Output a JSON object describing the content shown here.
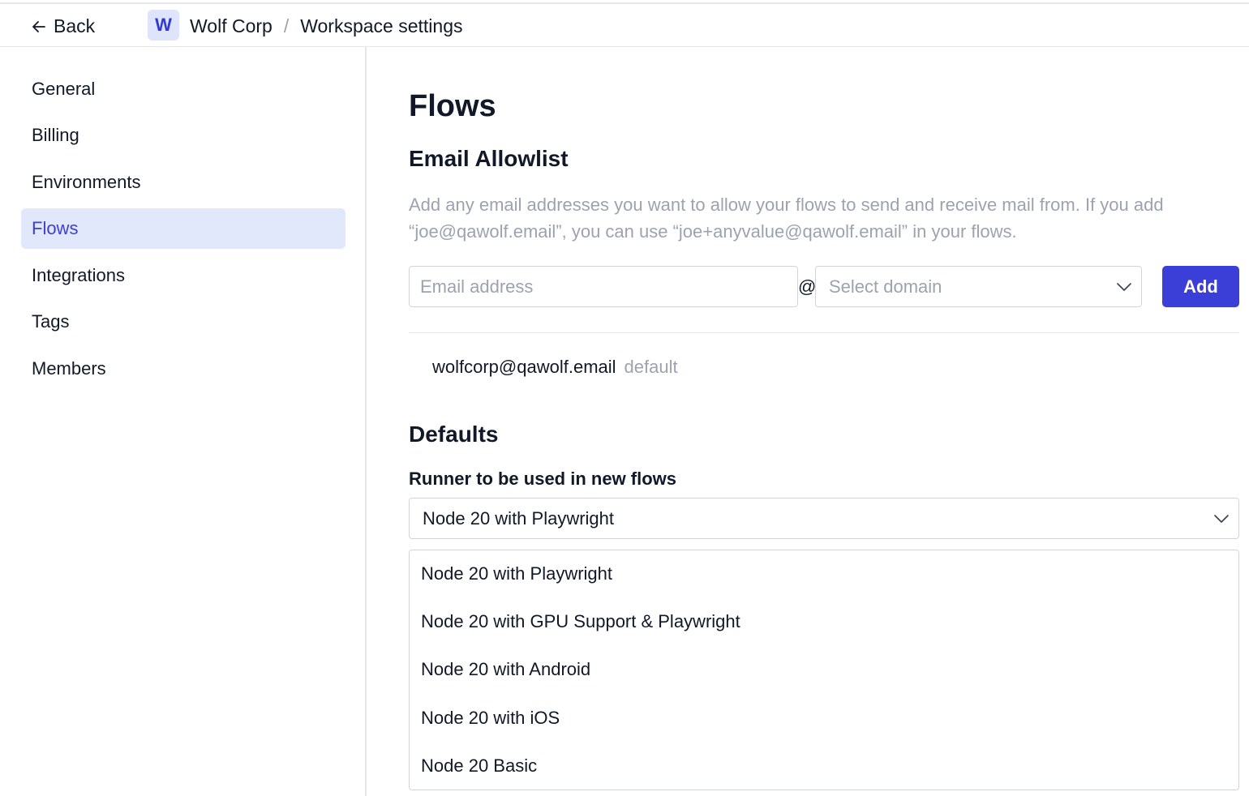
{
  "header": {
    "back_label": "Back",
    "workspace_initial": "W",
    "breadcrumb": [
      "Wolf Corp",
      "/",
      "Workspace settings"
    ]
  },
  "sidebar": {
    "items": [
      {
        "label": "General"
      },
      {
        "label": "Billing"
      },
      {
        "label": "Environments"
      },
      {
        "label": "Flows",
        "active": true
      },
      {
        "label": "Integrations"
      },
      {
        "label": "Tags"
      },
      {
        "label": "Members"
      }
    ]
  },
  "main": {
    "title": "Flows",
    "allowlist": {
      "heading": "Email Allowlist",
      "description": "Add any email addresses you want to allow your flows to send and receive mail from. If you add “joe@qawolf.email”, you can use “joe+anyvalue@qawolf.email” in your flows.",
      "email_placeholder": "Email address",
      "at_symbol": "@",
      "domain_placeholder": "Select domain",
      "add_label": "Add",
      "entries": [
        {
          "email": "wolfcorp@qawolf.email",
          "tag": "default"
        }
      ]
    },
    "defaults": {
      "heading": "Defaults",
      "runner_label": "Runner to be used in new flows",
      "runner_selected": "Node 20 with Playwright",
      "runner_options": [
        "Node 20 with Playwright",
        "Node 20 with GPU Support & Playwright",
        "Node 20 with Android",
        "Node 20 with iOS",
        "Node 20 Basic"
      ]
    }
  },
  "colors": {
    "accent": "#3b3fd8",
    "active_bg": "#e2e8fb",
    "muted_text": "#9ca3af",
    "border": "#d1d5db"
  }
}
